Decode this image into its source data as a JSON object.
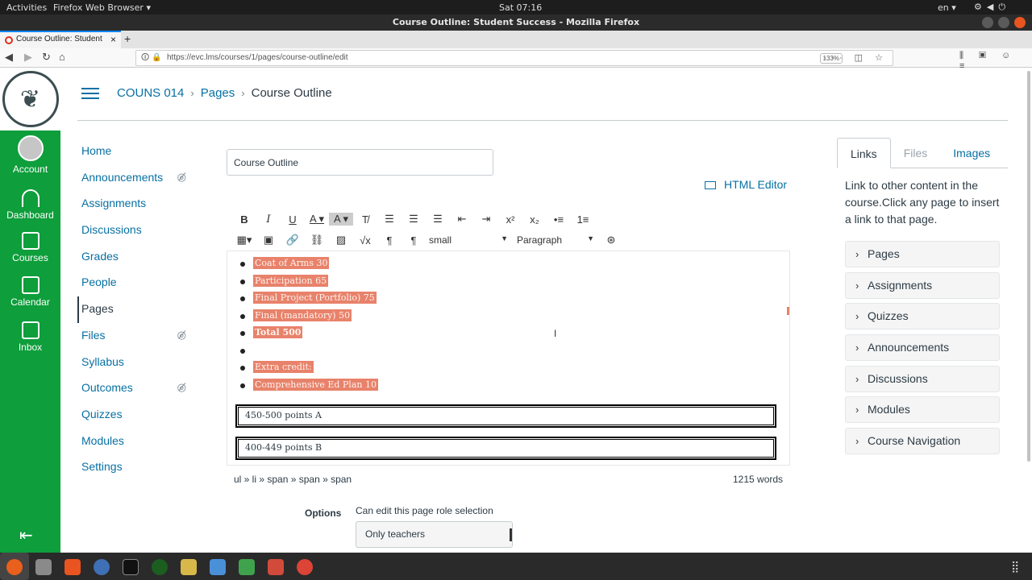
{
  "os_topbar": {
    "activities": "Activities",
    "app": "Firefox Web Browser ▾",
    "clock": "Sat 07:16",
    "lang": "en ▾"
  },
  "window": {
    "title": "Course Outline: Student Success - Mozilla Firefox"
  },
  "browser": {
    "tab_title": "Course Outline: Student",
    "url": "https://evc.lms/courses/1/pages/course-outline/edit",
    "zoom": "133%"
  },
  "global_nav": {
    "items": [
      {
        "label": "Account",
        "icon": "account-icon"
      },
      {
        "label": "Dashboard",
        "icon": "dashboard-icon"
      },
      {
        "label": "Courses",
        "icon": "courses-icon"
      },
      {
        "label": "Calendar",
        "icon": "calendar-icon"
      },
      {
        "label": "Inbox",
        "icon": "inbox-icon"
      }
    ]
  },
  "breadcrumb": {
    "course": "COUNS 014",
    "section": "Pages",
    "current": "Course Outline"
  },
  "course_nav": {
    "items": [
      {
        "label": "Home",
        "hidden": false
      },
      {
        "label": "Announcements",
        "hidden": true
      },
      {
        "label": "Assignments",
        "hidden": false
      },
      {
        "label": "Discussions",
        "hidden": false
      },
      {
        "label": "Grades",
        "hidden": false
      },
      {
        "label": "People",
        "hidden": false
      },
      {
        "label": "Pages",
        "hidden": false,
        "active": true
      },
      {
        "label": "Files",
        "hidden": true
      },
      {
        "label": "Syllabus",
        "hidden": false
      },
      {
        "label": "Outcomes",
        "hidden": true
      },
      {
        "label": "Quizzes",
        "hidden": false
      },
      {
        "label": "Modules",
        "hidden": false
      },
      {
        "label": "Settings",
        "hidden": false
      }
    ]
  },
  "editor": {
    "title_value": "Course Outline",
    "html_editor_label": "HTML Editor",
    "font_size": "small",
    "block_format": "Paragraph",
    "list_items": [
      {
        "text": "Coat of Arms 30",
        "bold": false
      },
      {
        "text": "Participation 65",
        "bold": false
      },
      {
        "text": "Final Project (Portfolio) 75",
        "bold": false
      },
      {
        "text": "Final (mandatory) 50",
        "bold": false
      },
      {
        "text": "Total 500",
        "bold": true
      },
      {
        "text": "",
        "bold": false
      },
      {
        "text": "Extra credit:",
        "bold": false
      },
      {
        "text": "Comprehensive Ed Plan 10",
        "bold": false
      }
    ],
    "grade_rows": [
      "450-500 points A",
      "400-449 points B"
    ],
    "path": "ul » li » span » span » span",
    "word_count": "1215 words"
  },
  "options": {
    "label": "Options",
    "role_label": "Can edit this page role selection",
    "role_value": "Only teachers"
  },
  "side_panel": {
    "tabs": [
      "Links",
      "Files",
      "Images"
    ],
    "help": "Link to other content in the course.Click any page to insert a link to that page.",
    "items": [
      "Pages",
      "Assignments",
      "Quizzes",
      "Announcements",
      "Discussions",
      "Modules",
      "Course Navigation"
    ]
  },
  "colors": {
    "canvas_green": "#0e9e3b",
    "link_blue": "#0770a3",
    "highlight": "#e8826b"
  }
}
